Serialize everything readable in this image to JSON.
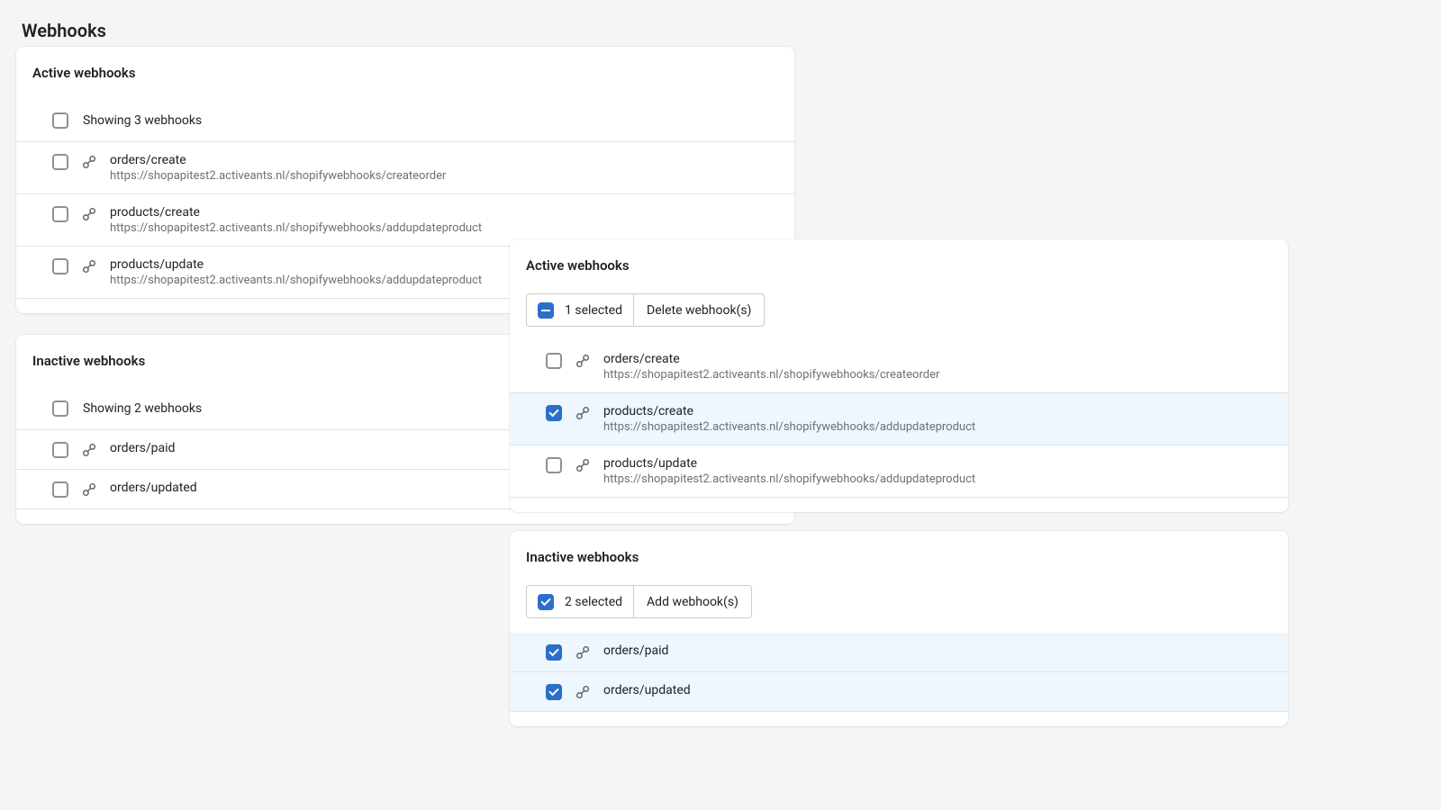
{
  "page": {
    "title": "Webhooks"
  },
  "left_active": {
    "title": "Active webhooks",
    "summary": "Showing 3 webhooks",
    "rows": [
      {
        "topic": "orders/create",
        "url": "https://shopapitest2.activeants.nl/shopifywebhooks/createorder"
      },
      {
        "topic": "products/create",
        "url": "https://shopapitest2.activeants.nl/shopifywebhooks/addupdateproduct"
      },
      {
        "topic": "products/update",
        "url": "https://shopapitest2.activeants.nl/shopifywebhooks/addupdateproduct"
      }
    ]
  },
  "left_inactive": {
    "title": "Inactive webhooks",
    "summary": "Showing 2 webhooks",
    "rows": [
      {
        "topic": "orders/paid"
      },
      {
        "topic": "orders/updated"
      }
    ]
  },
  "right_active": {
    "title": "Active webhooks",
    "selected_label": "1 selected",
    "action_label": "Delete webhook(s)",
    "rows_sel": [
      false,
      true,
      false
    ],
    "rows": [
      {
        "topic": "orders/create",
        "url": "https://shopapitest2.activeants.nl/shopifywebhooks/createorder"
      },
      {
        "topic": "products/create",
        "url": "https://shopapitest2.activeants.nl/shopifywebhooks/addupdateproduct"
      },
      {
        "topic": "products/update",
        "url": "https://shopapitest2.activeants.nl/shopifywebhooks/addupdateproduct"
      }
    ]
  },
  "right_inactive": {
    "title": "Inactive webhooks",
    "selected_label": "2 selected",
    "action_label": "Add webhook(s)",
    "rows_sel": [
      true,
      true
    ],
    "rows": [
      {
        "topic": "orders/paid"
      },
      {
        "topic": "orders/updated"
      }
    ]
  }
}
